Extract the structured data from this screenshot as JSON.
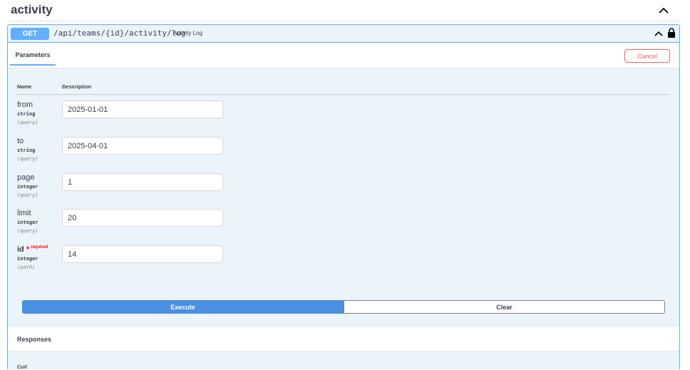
{
  "tag": {
    "title": "activity"
  },
  "operation": {
    "method": "GET",
    "path": "/api/teams/{id}/activity/log",
    "summary": "Activity Log"
  },
  "parameters_tab": {
    "label": "Parameters"
  },
  "cancel_label": "Cancel",
  "columns": {
    "name": "Name",
    "description": "Description"
  },
  "params": [
    {
      "name": "from",
      "type": "string",
      "location": "(query)",
      "value": "2025-01-01",
      "required": false
    },
    {
      "name": "to",
      "type": "string",
      "location": "(query)",
      "value": "2025-04-01",
      "required": false
    },
    {
      "name": "page",
      "type": "integer",
      "location": "(query)",
      "value": "1",
      "required": false
    },
    {
      "name": "limit",
      "type": "integer",
      "location": "(query)",
      "value": "20",
      "required": false
    },
    {
      "name": "id",
      "type": "integer",
      "location": "(path)",
      "value": "14",
      "required": true,
      "required_label": "required"
    }
  ],
  "buttons": {
    "execute": "Execute",
    "clear": "Clear"
  },
  "responses": {
    "title": "Responses",
    "curl_label": "Curl"
  },
  "colors": {
    "get_blue": "#61affe",
    "execute_blue": "#4990e2",
    "cancel_red": "#ff6060"
  }
}
